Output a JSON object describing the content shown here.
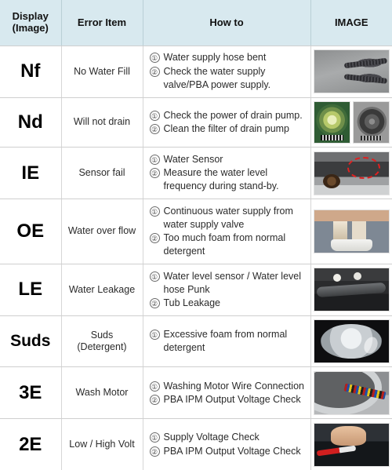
{
  "table": {
    "headers": [
      {
        "id": "display",
        "label": "Display\n(Image)",
        "line1": "Display",
        "line2": "(Image)"
      },
      {
        "id": "error_item",
        "label": "Error Item"
      },
      {
        "id": "how_to",
        "label": "How to"
      },
      {
        "id": "image",
        "label": "IMAGE"
      }
    ],
    "header_bg": "#d8e9ef",
    "border_color": "#cfcfcf",
    "rows": [
      {
        "display": "Nf",
        "error_item": "No Water Fill",
        "steps": [
          {
            "num": "①",
            "text": "Water supply hose bent"
          },
          {
            "num": "②",
            "text": "Check the water supply valve/PBA power supply."
          }
        ],
        "images": [
          {
            "name": "water-supply-hose-photo",
            "art": "t-hose"
          }
        ]
      },
      {
        "display": "Nd",
        "error_item": "Will not drain",
        "steps": [
          {
            "num": "①",
            "text": "Check the power of drain pump."
          },
          {
            "num": "②",
            "text": "Clean the filter of drain pump"
          }
        ],
        "images": [
          {
            "name": "drain-pump-clogged-photo",
            "art": "t-pump-green"
          },
          {
            "name": "drain-pump-clean-photo",
            "art": "t-pump-gray"
          }
        ]
      },
      {
        "display": "IE",
        "error_item": "Sensor fail",
        "steps": [
          {
            "num": "①",
            "text": "Water Sensor"
          },
          {
            "num": "②",
            "text": "Measure the water level frequency during stand-by."
          }
        ],
        "images": [
          {
            "name": "water-level-sensor-photo",
            "art": "t-sensor"
          }
        ]
      },
      {
        "display": "OE",
        "error_item": "Water over flow",
        "steps": [
          {
            "num": "①",
            "text": "Continuous water supply from water supply valve"
          },
          {
            "num": "②",
            "text": "Too much foam from normal detergent"
          }
        ],
        "images": [
          {
            "name": "water-supply-valve-photo",
            "art": "t-valve"
          }
        ]
      },
      {
        "display": "LE",
        "error_item": "Water Leakage",
        "steps": [
          {
            "num": "①",
            "text": "Water level sensor / Water level hose Punk"
          },
          {
            "num": "②",
            "text": "Tub Leakage"
          }
        ],
        "images": [
          {
            "name": "water-level-hose-photo",
            "art": "t-leak"
          }
        ]
      },
      {
        "display": "Suds",
        "error_item": "Suds (Detergent)",
        "steps": [
          {
            "num": "①",
            "text": "Excessive foam from normal detergent"
          }
        ],
        "images": [
          {
            "name": "tub-foam-photo",
            "art": "t-tub"
          }
        ]
      },
      {
        "display": "3E",
        "error_item": "Wash Motor",
        "steps": [
          {
            "num": "①",
            "text": "Washing Motor Wire Connection"
          },
          {
            "num": "②",
            "text": "PBA IPM Output Voltage Check"
          }
        ],
        "images": [
          {
            "name": "washing-motor-wire-photo",
            "art": "t-motor"
          }
        ]
      },
      {
        "display": "2E",
        "error_item": "Low / High Volt",
        "steps": [
          {
            "num": "①",
            "text": "Supply Voltage Check"
          },
          {
            "num": "②",
            "text": "PBA IPM Output Voltage Check"
          }
        ],
        "images": [
          {
            "name": "supply-voltage-check-photo",
            "art": "t-volt"
          }
        ]
      }
    ]
  }
}
